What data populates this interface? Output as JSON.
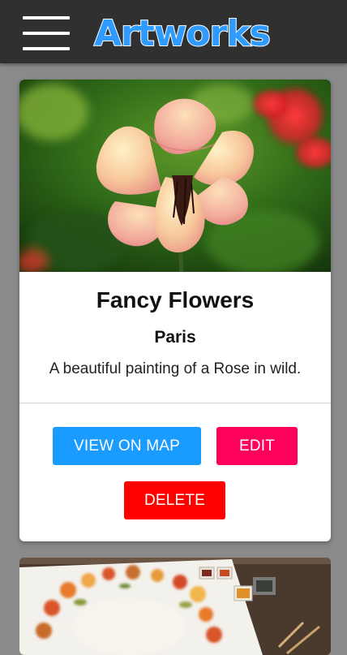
{
  "app": {
    "title": "Artworks",
    "title_color": "#2f9bff",
    "header_bg": "#303030"
  },
  "menu": {
    "icon": "hamburger-menu-icon"
  },
  "artworks": [
    {
      "title": "Fancy Flowers",
      "location": "Paris",
      "description": "A beautiful painting of a Rose in wild.",
      "image": "rose-flower-photo",
      "actions": {
        "view_on_map": "VIEW ON MAP",
        "edit": "EDIT",
        "delete": "DELETE"
      }
    },
    {
      "image": "watercolor-wreath-photo"
    }
  ],
  "colors": {
    "view_on_map": "#1a9bff",
    "edit": "#ff005c",
    "delete": "#ff0000",
    "page_bg": "#8a8a8a"
  }
}
